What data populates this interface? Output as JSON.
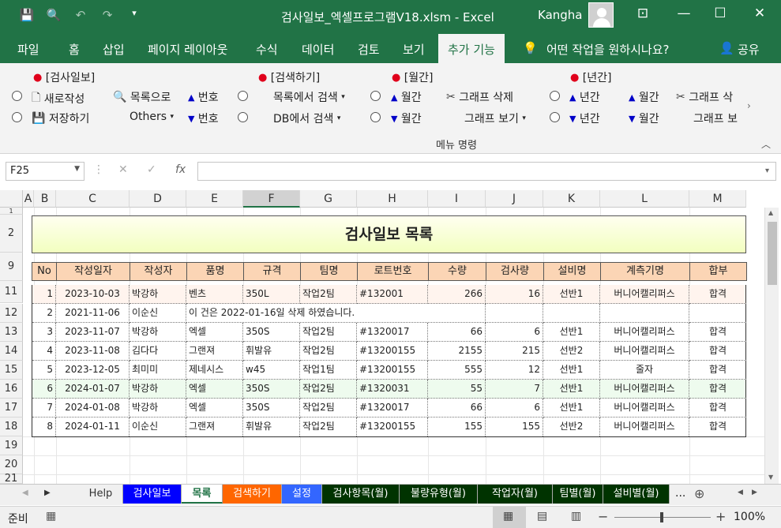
{
  "window": {
    "title": "검사일보_엑셀프로그램V18.xlsm  -  Excel",
    "user": "Kangha"
  },
  "tabs": [
    "파일",
    "홈",
    "삽입",
    "페이지 레이아웃",
    "수식",
    "데이터",
    "검토",
    "보기",
    "추가 기능"
  ],
  "tell_me": "어떤 작업을 원하시나요?",
  "share": "공유",
  "ribbon": {
    "sec1": "[검사일보]",
    "new": "새로작성",
    "save": "저장하기",
    "list_to": "목록으로",
    "others": "Others",
    "num_up": "번호",
    "num_down": "번호",
    "sec2": "[검색하기]",
    "search_list": "목록에서 검색",
    "search_db": "DB에서 검색",
    "sec3": "[월간]",
    "monthly_up": "월간",
    "monthly_down": "월간",
    "graph_delete": "그래프 삭제",
    "graph_view": "그래프 보기",
    "sec4": "[년간]",
    "yearly_up": "년간",
    "yearly_down": "년간",
    "monthly2_up": "월간",
    "monthly2_down": "월간",
    "graph_delete2": "그래프 삭",
    "graph_view2": "그래프 보",
    "group_label": "메뉴 명령"
  },
  "namebox": "F25",
  "columns": [
    "A",
    "B",
    "C",
    "D",
    "E",
    "F",
    "G",
    "H",
    "I",
    "J",
    "K",
    "L",
    "M"
  ],
  "rows": [
    "1",
    "2",
    "9",
    "11",
    "12",
    "13",
    "14",
    "15",
    "16",
    "17",
    "18",
    "19",
    "20",
    "21"
  ],
  "sheet_title": "검사일보 목록",
  "headers": [
    "No",
    "작성일자",
    "작성자",
    "품명",
    "규격",
    "팀명",
    "로트번호",
    "수량",
    "검사량",
    "설비명",
    "계측기명",
    "합부"
  ],
  "records": [
    [
      "1",
      "2023-10-03",
      "박강하",
      "벤츠",
      "350L",
      "작업2팀",
      "#132001",
      "266",
      "16",
      "선반1",
      "버니어캘리퍼스",
      "합격"
    ],
    [
      "2",
      "2021-11-06",
      "이순신",
      "이 건은 2022-01-16일 삭제 하였습니다.",
      "",
      "",
      "",
      "",
      "",
      "",
      "",
      ""
    ],
    [
      "3",
      "2023-11-07",
      "박강하",
      "엑셀",
      "350S",
      "작업2팀",
      "#1320017",
      "66",
      "6",
      "선반1",
      "버니어캘리퍼스",
      "합격"
    ],
    [
      "4",
      "2023-11-08",
      "김다다",
      "그랜져",
      "휘발유",
      "작업2팀",
      "#13200155",
      "2155",
      "215",
      "선반2",
      "버니어캘리퍼스",
      "합격"
    ],
    [
      "5",
      "2023-12-05",
      "최미미",
      "제네시스",
      "w45",
      "작업1팀",
      "#13200155",
      "555",
      "12",
      "선반1",
      "줄자",
      "합격"
    ],
    [
      "6",
      "2024-01-07",
      "박강하",
      "엑셀",
      "350S",
      "작업2팀",
      "#1320031",
      "55",
      "7",
      "선반1",
      "버니어캘리퍼스",
      "합격"
    ],
    [
      "7",
      "2024-01-08",
      "박강하",
      "엑셀",
      "350S",
      "작업2팀",
      "#1320017",
      "66",
      "6",
      "선반1",
      "버니어캘리퍼스",
      "합격"
    ],
    [
      "8",
      "2024-01-11",
      "이순신",
      "그랜져",
      "휘발유",
      "작업2팀",
      "#13200155",
      "155",
      "155",
      "선반2",
      "버니어캘리퍼스",
      "합격"
    ]
  ],
  "sheet_tabs": [
    {
      "label": "Help",
      "bg": "#f0f0f0",
      "fg": "#333"
    },
    {
      "label": "검사일보",
      "bg": "#0000ff",
      "fg": "#ffffff"
    },
    {
      "label": "목록",
      "bg": "#ffffff",
      "fg": "#217346"
    },
    {
      "label": "검색하기",
      "bg": "#ff6600",
      "fg": "#ffffff"
    },
    {
      "label": "설정",
      "bg": "#3366ff",
      "fg": "#ffffff"
    },
    {
      "label": "검사항목(월)",
      "bg": "#003300",
      "fg": "#ffffff"
    },
    {
      "label": "불량유형(월)",
      "bg": "#003300",
      "fg": "#ffffff"
    },
    {
      "label": "작업자(월)",
      "bg": "#003300",
      "fg": "#ffffff"
    },
    {
      "label": "팀별(월)",
      "bg": "#003300",
      "fg": "#ffffff"
    },
    {
      "label": "설비별(월)",
      "bg": "#003300",
      "fg": "#ffffff"
    }
  ],
  "more_tabs": "...",
  "status": {
    "ready": "준비",
    "zoom": "100%"
  }
}
